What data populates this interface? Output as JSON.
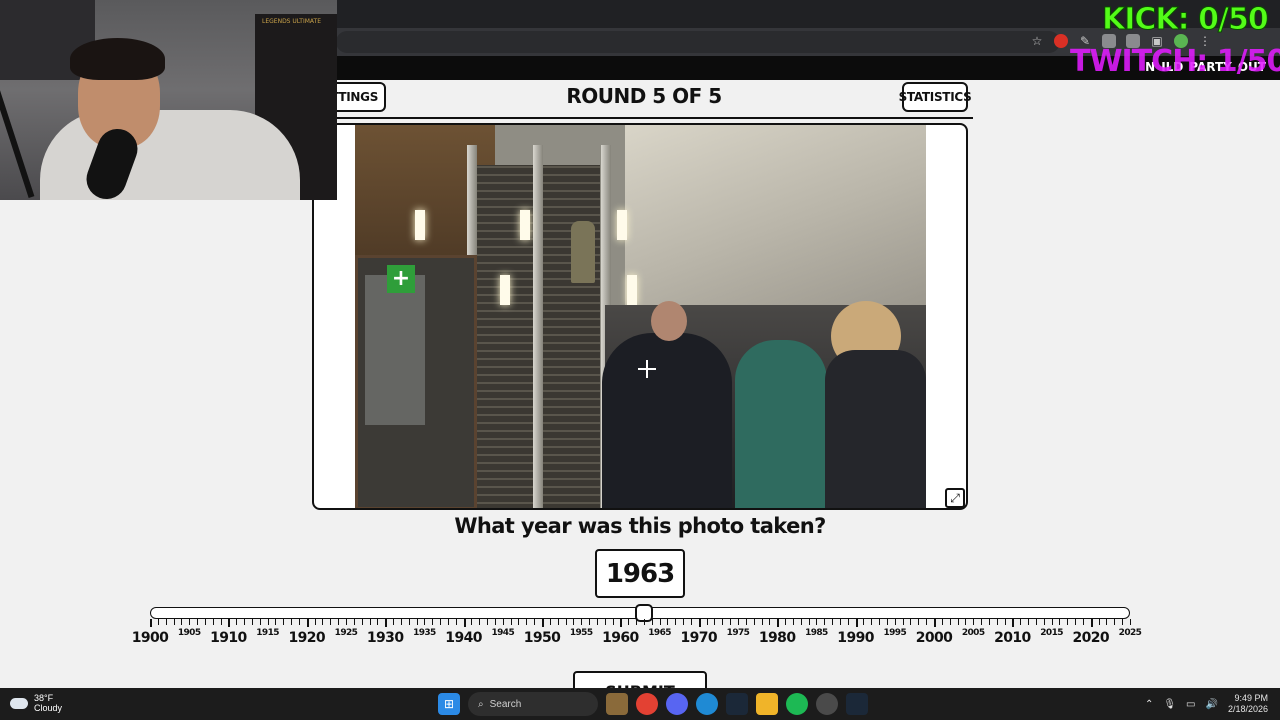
{
  "overlays": {
    "kick_counter": "KICK: 0/50",
    "twitch_counter": "TWITCH: 1/50"
  },
  "site_nav": [
    "N",
    "ILD",
    "PARTY",
    "OUT"
  ],
  "game": {
    "settings_label": "SETTINGS",
    "round_title": "ROUND 5 OF 5",
    "statistics_label": "STATISTICS",
    "question": "What year was this photo taken?",
    "year_value": "1963",
    "submit_label": "SUBMIT",
    "slider": {
      "min": 1900,
      "max": 2025,
      "value": 1963,
      "major_labels": [
        "1900",
        "1910",
        "1920",
        "1930",
        "1940",
        "1950",
        "1960",
        "1970",
        "1980",
        "1990",
        "2000",
        "2010",
        "2020"
      ],
      "minor_labels": [
        "1905",
        "1915",
        "1925",
        "1935",
        "1945",
        "1955",
        "1965",
        "1975",
        "1985",
        "1995",
        "2005",
        "2015",
        "2025"
      ]
    }
  },
  "webcam": {
    "shelf_label": "LEGENDS ULTIMATE"
  },
  "taskbar": {
    "weather_temp": "38°F",
    "weather_desc": "Cloudy",
    "search_label": "Search",
    "time": "9:49 PM",
    "date": "2/18/2026"
  },
  "colors": {
    "kick_green": "#53fc18",
    "twitch_purple": "#e11cff"
  }
}
